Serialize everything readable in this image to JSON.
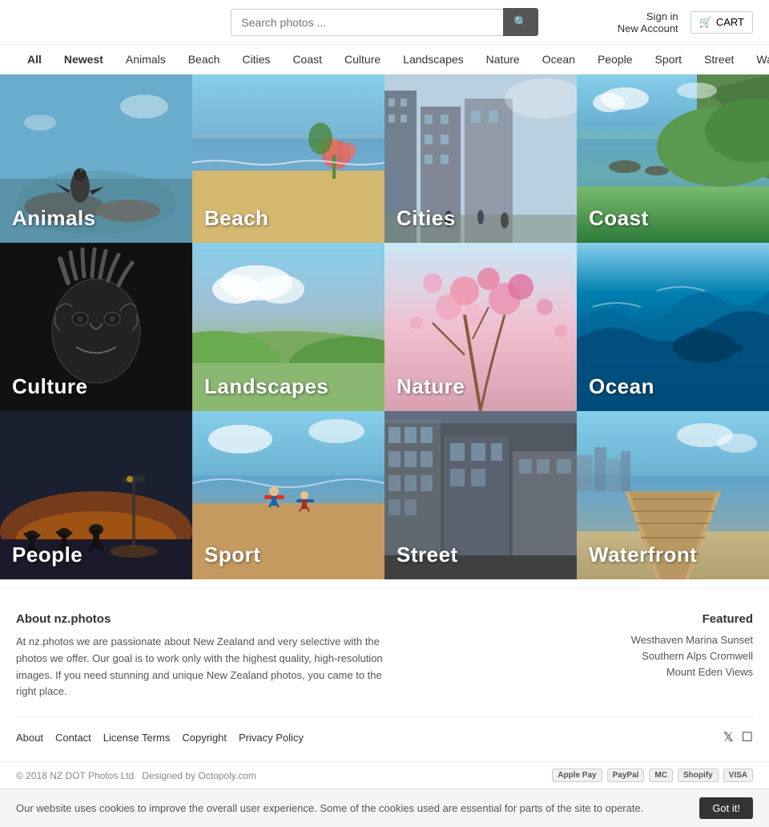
{
  "header": {
    "search_placeholder": "Search photos ...",
    "search_btn_icon": "🔍",
    "sign_in": "Sign in",
    "new_account": "New Account",
    "cart_label": "CART",
    "cart_icon": "🛒"
  },
  "nav": {
    "items": [
      {
        "label": "All",
        "active": false
      },
      {
        "label": "Newest",
        "active": true
      },
      {
        "label": "Animals",
        "active": false
      },
      {
        "label": "Beach",
        "active": false
      },
      {
        "label": "Cities",
        "active": false
      },
      {
        "label": "Coast",
        "active": false
      },
      {
        "label": "Culture",
        "active": false
      },
      {
        "label": "Landscapes",
        "active": false
      },
      {
        "label": "Nature",
        "active": false
      },
      {
        "label": "Ocean",
        "active": false
      },
      {
        "label": "People",
        "active": false
      },
      {
        "label": "Sport",
        "active": false
      },
      {
        "label": "Street",
        "active": false
      },
      {
        "label": "Waterfront",
        "active": false
      }
    ]
  },
  "categories": [
    {
      "label": "Animals",
      "bg_class": "bg-animals"
    },
    {
      "label": "Beach",
      "bg_class": "bg-beach"
    },
    {
      "label": "Cities",
      "bg_class": "bg-cities"
    },
    {
      "label": "Coast",
      "bg_class": "bg-coast"
    },
    {
      "label": "Culture",
      "bg_class": "bg-culture"
    },
    {
      "label": "Landscapes",
      "bg_class": "bg-landscapes"
    },
    {
      "label": "Nature",
      "bg_class": "bg-nature"
    },
    {
      "label": "Ocean",
      "bg_class": "bg-ocean"
    },
    {
      "label": "People",
      "bg_class": "bg-people"
    },
    {
      "label": "Sport",
      "bg_class": "bg-sport"
    },
    {
      "label": "Street",
      "bg_class": "bg-street"
    },
    {
      "label": "Waterfront",
      "bg_class": "bg-waterfront"
    }
  ],
  "footer": {
    "about_title": "About nz.photos",
    "about_text": "At nz.photos we are passionate about New Zealand and very selective with the photos we offer. Our goal is to work only with the highest quality, high-resolution images. If you need stunning and unique New Zealand photos, you came to the right place.",
    "featured_title": "Featured",
    "featured_links": [
      "Westhaven Marina Sunset",
      "Southern Alps Cromwell",
      "Mount Eden Views"
    ],
    "links": [
      {
        "label": "About"
      },
      {
        "label": "Contact"
      },
      {
        "label": "License Terms"
      },
      {
        "label": "Copyright"
      },
      {
        "label": "Privacy Policy"
      }
    ],
    "copyright": "© 2018 NZ DOT Photos Ltd",
    "designed_by": "Designed by Octopoly.com",
    "payment_icons": [
      "ApplePay",
      "PayPal",
      "Mastercard",
      "Shopify",
      "VISA"
    ]
  },
  "cookie": {
    "text": "Our website uses cookies to improve the overall user experience. Some of the cookies used are essential for parts of the site to operate.",
    "btn_label": "Got it!"
  }
}
